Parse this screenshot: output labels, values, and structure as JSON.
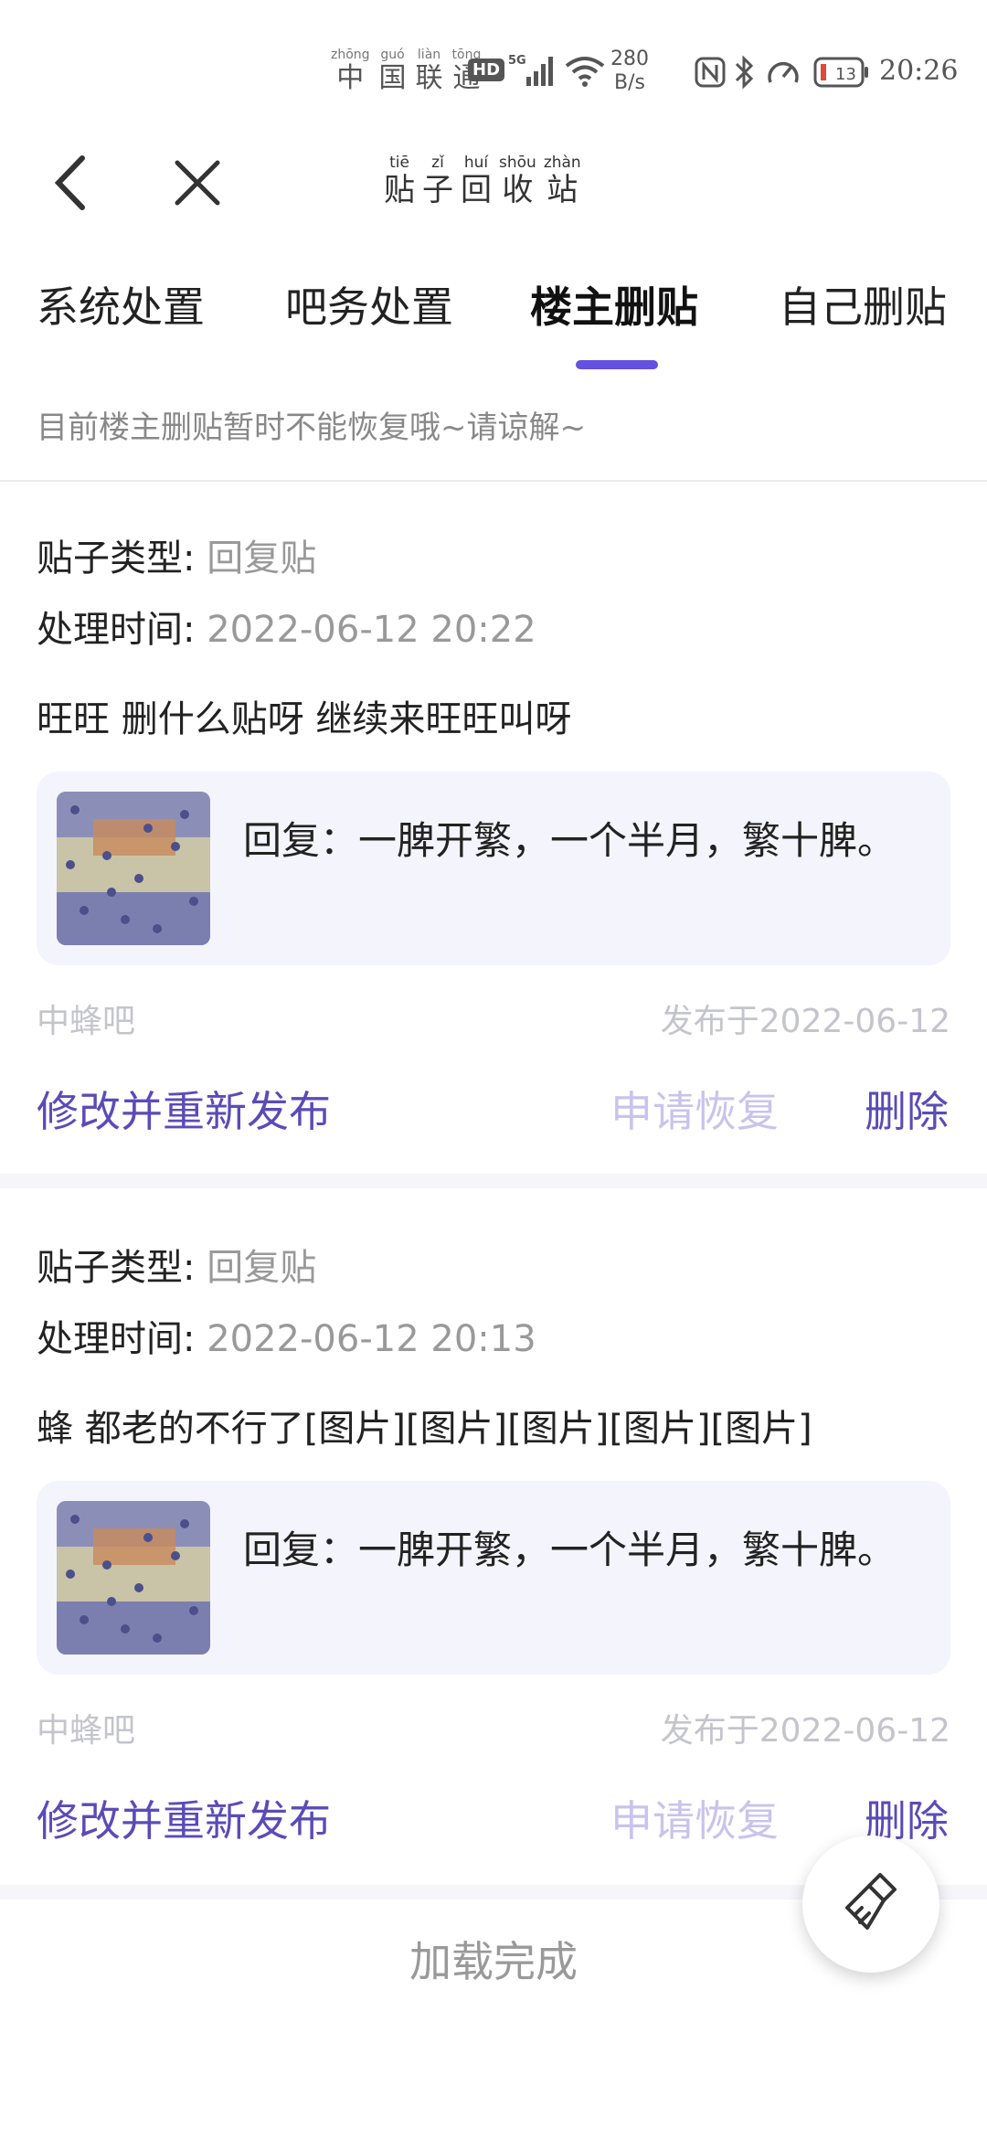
{
  "status_bar": {
    "carrier": [
      {
        "py": "zhōng",
        "hz": "中"
      },
      {
        "py": "guó",
        "hz": "国"
      },
      {
        "py": "liàn",
        "hz": "联"
      },
      {
        "py": "tōng",
        "hz": "通"
      }
    ],
    "hd": "HD",
    "network": "5G",
    "speed_value": "280",
    "speed_unit": "B/s",
    "time": "20:26",
    "icons": [
      "signal-icon",
      "wifi-icon",
      "nfc-icon",
      "bluetooth-icon",
      "speed-gauge-icon",
      "battery-icon"
    ]
  },
  "nav": {
    "title": [
      {
        "py": "tiē",
        "hz": "贴"
      },
      {
        "py": "zǐ",
        "hz": "子"
      },
      {
        "py": "huí",
        "hz": "回"
      },
      {
        "py": "shōu",
        "hz": "收"
      },
      {
        "py": "zhàn",
        "hz": "站"
      }
    ]
  },
  "tabs": [
    {
      "label": "系统处置",
      "active": false
    },
    {
      "label": "吧务处置",
      "active": false
    },
    {
      "label": "楼主删贴",
      "active": true
    },
    {
      "label": "自己删贴",
      "active": false
    }
  ],
  "accent_color": "#6451e0",
  "notice": "目前楼主删贴暂时不能恢复哦~请谅解~",
  "type_label": "贴子类型:",
  "time_label": "处理时间:",
  "posts": [
    {
      "type": "回复贴",
      "time": "2022-06-12 20:22",
      "content": "旺旺 删什么贴呀 继续来旺旺叫呀",
      "quote": "回复：一脾开繁，一个半月，繁十脾。",
      "forum": "中蜂吧",
      "published": "发布于2022-06-12",
      "edit_label": "修改并重新发布",
      "restore_label": "申请恢复",
      "delete_label": "删除"
    },
    {
      "type": "回复贴",
      "time": "2022-06-12 20:13",
      "content": "蜂 都老的不行了[图片][图片][图片][图片][图片]",
      "quote": "回复：一脾开繁，一个半月，繁十脾。",
      "forum": "中蜂吧",
      "published": "发布于2022-06-12",
      "edit_label": "修改并重新发布",
      "restore_label": "申请恢复",
      "delete_label": "删除"
    }
  ],
  "load_status": "加载完成"
}
